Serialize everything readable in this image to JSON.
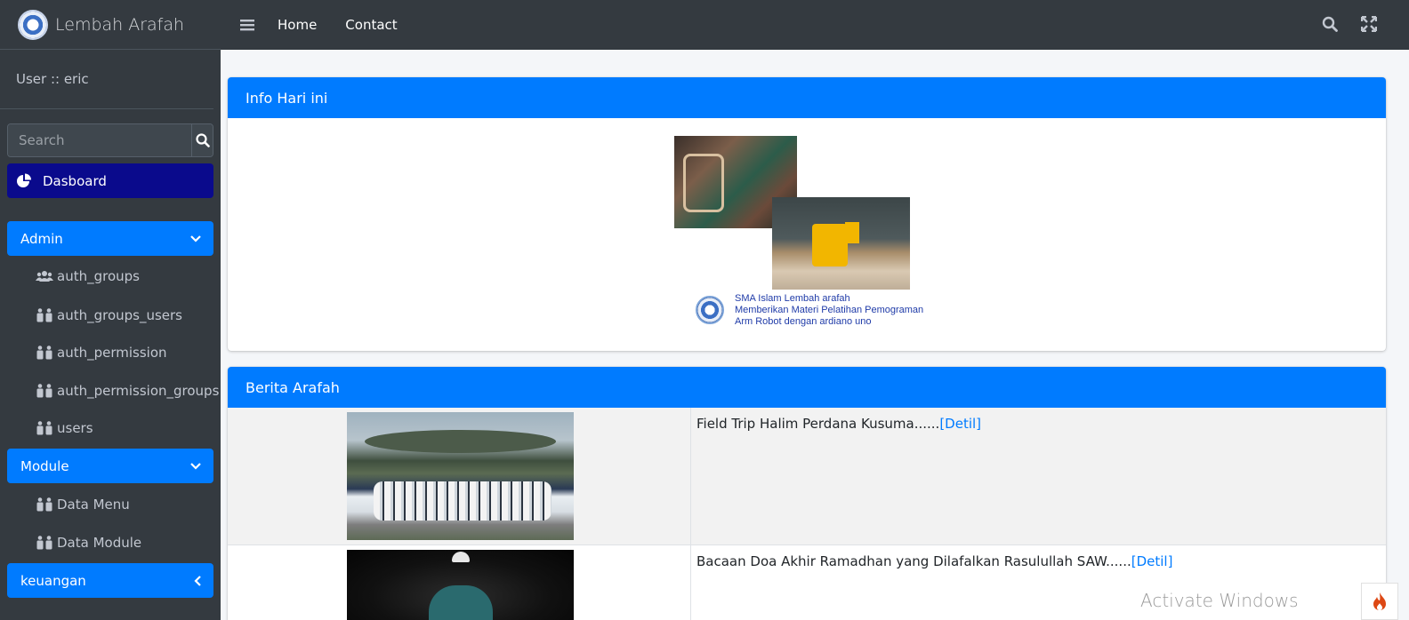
{
  "brand": {
    "name": "Lembah Arafah"
  },
  "user": {
    "label": "User :: eric"
  },
  "search": {
    "placeholder": "Search"
  },
  "sidebar": {
    "dashboard": "Dasboard",
    "admin_group": "Admin",
    "admin_items": [
      "auth_groups",
      "auth_groups_users",
      "auth_permission",
      "auth_permission_groups",
      "users"
    ],
    "module_group": "Module",
    "module_items": [
      "Data Menu",
      "Data Module"
    ],
    "keuangan_group": "keuangan"
  },
  "topbar": {
    "home": "Home",
    "contact": "Contact"
  },
  "info_card": {
    "title": "Info Hari ini",
    "poster_lines": [
      "SMA Islam Lembah arafah",
      "Memberikan Materi Pelatihan Pemograman",
      "Arm Robot dengan ardiano uno"
    ]
  },
  "news_card": {
    "title": "Berita Arafah",
    "items": [
      {
        "text": "Field Trip Halim Perdana Kusuma......",
        "link": "[Detil]"
      },
      {
        "text": "Bacaan Doa Akhir Ramadhan yang Dilafalkan Rasulullah SAW......",
        "link": "[Detil]"
      }
    ]
  },
  "watermark": "Activate Windows",
  "colors": {
    "sidebar_bg": "#343a40",
    "primary": "#007bff",
    "dashboard_active": "#0a0a8c",
    "content_bg": "#f4f6f9"
  },
  "icons": [
    "hamburger-icon",
    "search-icon",
    "expand-icon",
    "pie-chart-icon",
    "chevron-down-icon",
    "chevron-left-icon",
    "users-icon",
    "user-group-icon",
    "flame-icon"
  ]
}
